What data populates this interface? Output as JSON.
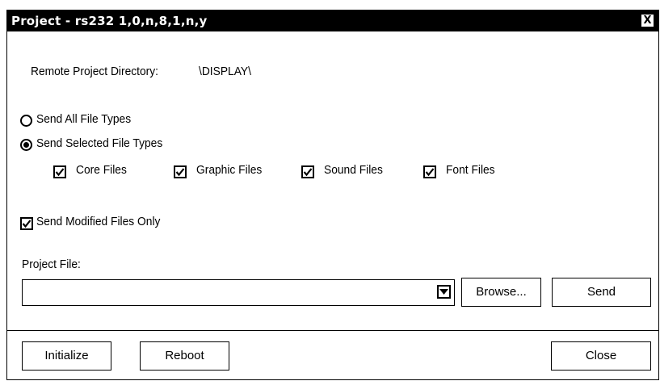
{
  "window": {
    "title": "Project - rs232 1,0,n,8,1,n,y",
    "close_glyph": "X"
  },
  "remote_dir": {
    "label": "Remote Project Directory:",
    "value": "\\DISPLAY\\"
  },
  "send_mode": {
    "options": [
      {
        "label": "Send All File Types",
        "selected": false
      },
      {
        "label": "Send Selected File Types",
        "selected": true
      }
    ]
  },
  "file_types": [
    {
      "label": "Core Files",
      "checked": true
    },
    {
      "label": "Graphic Files",
      "checked": true
    },
    {
      "label": "Sound Files",
      "checked": true
    },
    {
      "label": "Font Files",
      "checked": true
    }
  ],
  "modified_only": {
    "label": "Send Modified Files Only",
    "checked": true
  },
  "project_file": {
    "label": "Project File:",
    "value": "",
    "placeholder": ""
  },
  "buttons": {
    "browse": "Browse...",
    "send": "Send",
    "initialize": "Initialize",
    "reboot": "Reboot",
    "close": "Close"
  },
  "icons": {
    "window_close": "close-icon",
    "dropdown": "chevron-down-icon",
    "check": "checkmark-icon",
    "radio_dot": "radio-dot-icon"
  },
  "colors": {
    "titlebar": "#000000",
    "title_text": "#ffffff",
    "background": "#ffffff",
    "border": "#000000"
  }
}
